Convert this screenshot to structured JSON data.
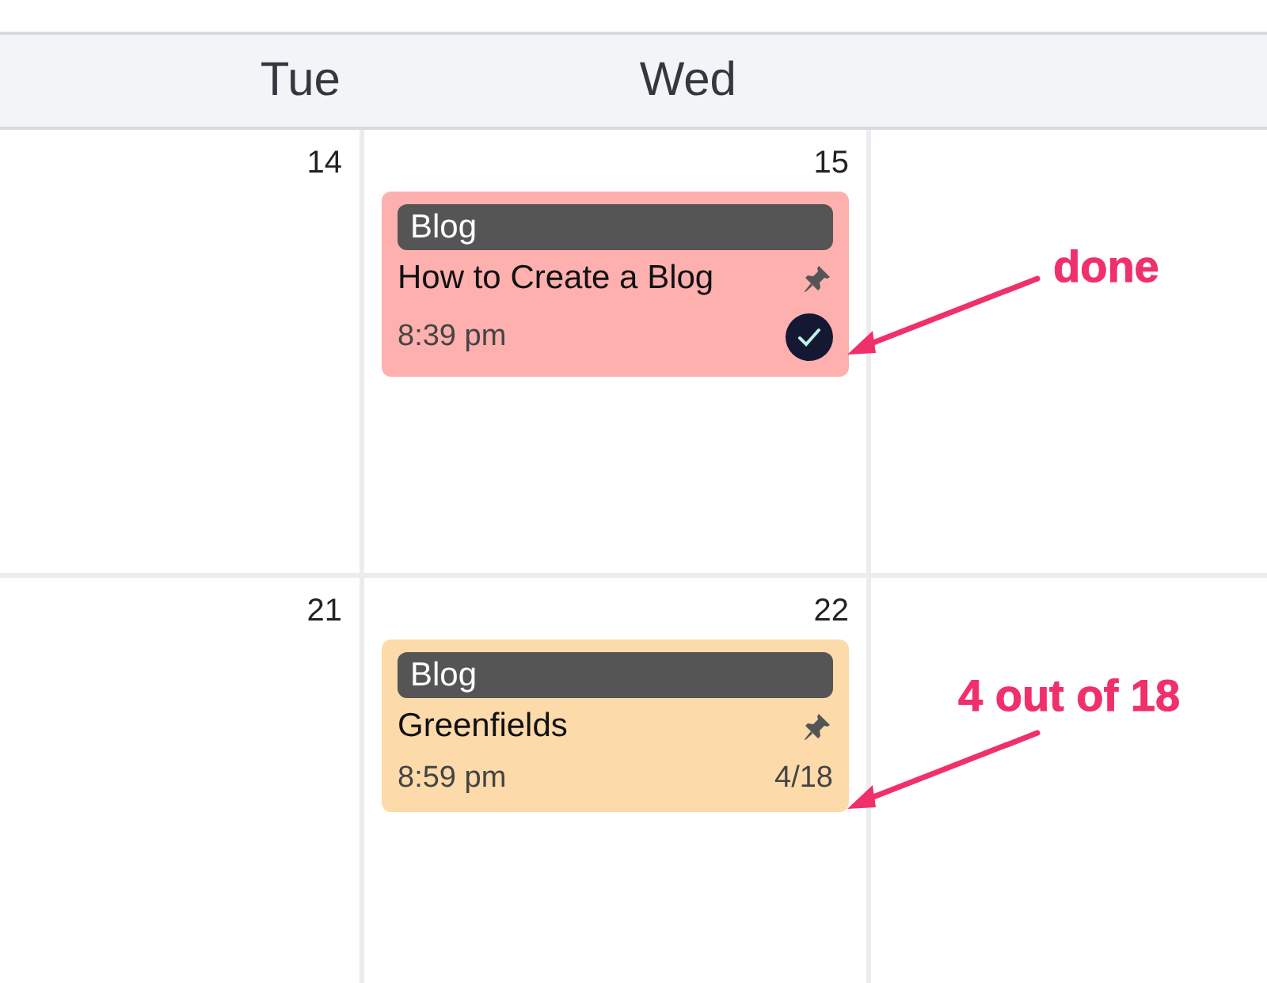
{
  "header": {
    "days": [
      "Tue",
      "Wed"
    ]
  },
  "weeks": [
    {
      "days": [
        {
          "number": "14"
        },
        {
          "number": "15",
          "events": [
            {
              "tag": "Blog",
              "title": "How to Create a Blog",
              "time": "8:39 pm",
              "pinned": true,
              "done": true,
              "color": "#fdb0ae"
            }
          ]
        }
      ]
    },
    {
      "days": [
        {
          "number": "21"
        },
        {
          "number": "22",
          "events": [
            {
              "tag": "Blog",
              "title": "Greenfields",
              "time": "8:59 pm",
              "pinned": true,
              "done": false,
              "progress": "4/18",
              "color": "#fddaaa"
            }
          ]
        }
      ]
    }
  ],
  "annotations": [
    {
      "text": "done"
    },
    {
      "text": "4 out of 18"
    }
  ]
}
